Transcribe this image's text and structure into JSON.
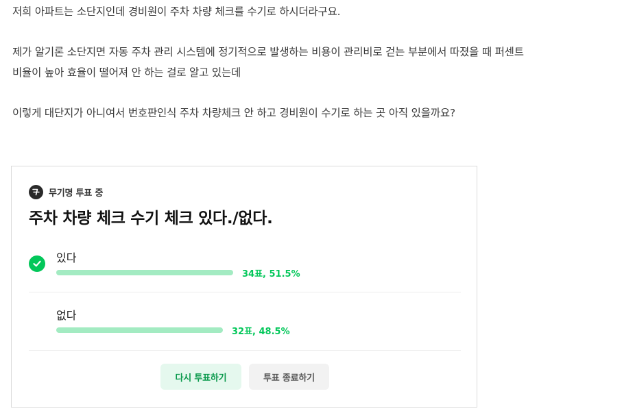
{
  "post": {
    "paragraph_1": "저희 아파트는 소단지인데 경비원이 주차 차량 체크를 수기로 하시더라구요.",
    "paragraph_2_line_1": "제가 알기론 소단지면 자동 주차 관리 시스템에 정기적으로 발생하는 비용이 관리비로 걷는 부분에서 따졌을 때 퍼센트",
    "paragraph_2_line_2": "비율이 높아 효율이 떨어져 안 하는 걸로 알고 있는데",
    "paragraph_3": "이렇게 대단지가 아니여서 번호판인식 주차 차량체크 안 하고 경비원이 수기로 하는 곳 아직 있을까요?"
  },
  "poll": {
    "badge": "무기명 투표 중",
    "badge_icon": "vote-icon",
    "title": "주차 차량 체크 수기 체크 있다./없다.",
    "options": [
      {
        "label": "있다",
        "result": "34표, 51.5%",
        "percent": 51.5,
        "selected": true
      },
      {
        "label": "없다",
        "result": "32표, 48.5%",
        "percent": 48.5,
        "selected": false
      }
    ],
    "revote_label": "다시 투표하기",
    "end_label": "투표 종료하기",
    "colors": {
      "accent": "#03c75a",
      "bar": "#a3ebc2",
      "revote_bg": "#e5f8ee",
      "end_bg": "#f2f2f2"
    }
  }
}
